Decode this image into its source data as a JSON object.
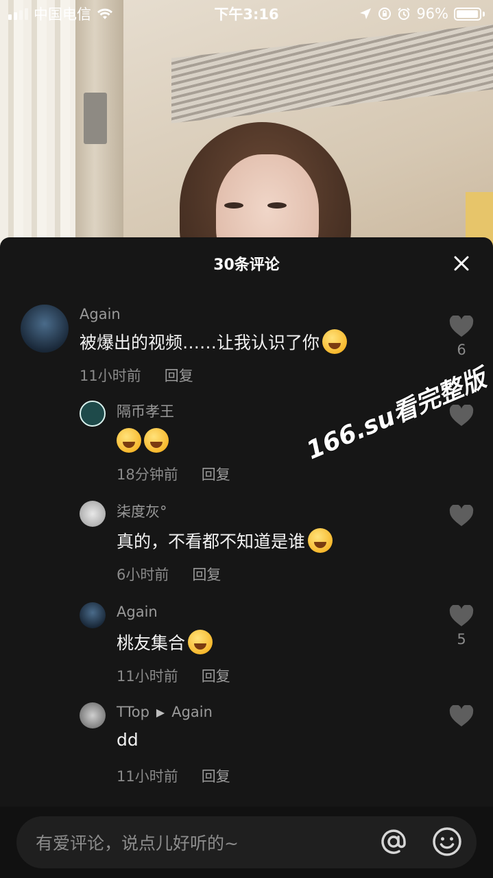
{
  "status_bar": {
    "carrier": "中国电信",
    "time": "下午3:16",
    "battery_percent": "96%",
    "battery_level": 0.96,
    "icons": [
      "signal-icon",
      "wifi-icon",
      "location-icon",
      "rotation-lock-icon",
      "alarm-icon",
      "battery-icon"
    ]
  },
  "sheet": {
    "title": "30条评论",
    "close_icon": "close-icon"
  },
  "comments": [
    {
      "username": "Again",
      "text": "被爆出的视频……让我认识了你",
      "emoji": "rolling-laughing-emoji",
      "time": "11小时前",
      "reply_label": "回复",
      "likes": "6",
      "is_reply": false
    },
    {
      "username": "隔币孝王",
      "text": "",
      "emoji": "rolling-laughing-emoji",
      "emoji2": "salute-emoji",
      "time": "18分钟前",
      "reply_label": "回复",
      "likes": "",
      "is_reply": true
    },
    {
      "username": "柒度灰°",
      "text": "真的，不看都不知道是谁",
      "emoji": "crying-laughing-emoji",
      "time": "6小时前",
      "reply_label": "回复",
      "likes": "",
      "is_reply": true
    },
    {
      "username": "Again",
      "text": "桃友集合",
      "emoji": "crying-laughing-emoji",
      "time": "11小时前",
      "reply_label": "回复",
      "likes": "5",
      "is_reply": true
    },
    {
      "username": "TTop",
      "reply_to": "Again",
      "text": "dd",
      "time": "11小时前",
      "reply_label": "回复",
      "likes": "",
      "is_reply": true
    }
  ],
  "watermark": "166.su看完整版",
  "input": {
    "placeholder": "有爱评论，说点儿好听的~",
    "at_icon": "at-icon",
    "emoji_icon": "emoji-icon"
  },
  "colors": {
    "sheet_bg": "#161616",
    "text_primary": "#f2f2f2",
    "text_secondary": "#8a8a8a"
  }
}
